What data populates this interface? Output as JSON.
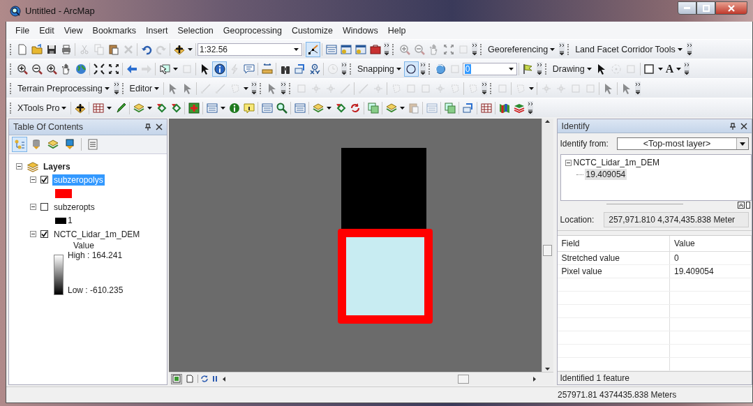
{
  "window": {
    "title": "Untitled - ArcMap"
  },
  "menu": [
    "File",
    "Edit",
    "View",
    "Bookmarks",
    "Insert",
    "Selection",
    "Geoprocessing",
    "Customize",
    "Windows",
    "Help"
  ],
  "toolbars": [
    {
      "items": [
        {
          "kind": "grip"
        },
        {
          "kind": "tool",
          "selected": false,
          "disabled": false
        },
        {
          "kind": "tool",
          "selected": false,
          "disabled": false
        },
        {
          "kind": "tool",
          "selected": false,
          "disabled": false
        },
        {
          "kind": "tool",
          "selected": false,
          "disabled": false
        },
        {
          "kind": "separator"
        },
        {
          "kind": "tool",
          "selected": false,
          "disabled": true
        },
        {
          "kind": "tool",
          "selected": false,
          "disabled": true
        },
        {
          "kind": "tool",
          "selected": false,
          "disabled": false
        },
        {
          "kind": "tool",
          "selected": false,
          "disabled": true
        },
        {
          "kind": "separator"
        },
        {
          "kind": "tool",
          "selected": false,
          "disabled": false
        },
        {
          "kind": "tool",
          "selected": false,
          "disabled": true
        },
        {
          "kind": "separator"
        },
        {
          "kind": "tool",
          "selected": false,
          "disabled": false
        },
        {
          "kind": "caret"
        },
        {
          "kind": "separator"
        },
        {
          "kind": "scale",
          "value": "1:32.56"
        },
        {
          "kind": "separator"
        },
        {
          "kind": "tool",
          "selected": true,
          "disabled": false
        },
        {
          "kind": "separator"
        },
        {
          "kind": "tool",
          "selected": false,
          "disabled": false
        },
        {
          "kind": "tool",
          "selected": false,
          "disabled": false
        },
        {
          "kind": "tool",
          "selected": false,
          "disabled": false
        },
        {
          "kind": "tool",
          "selected": false,
          "disabled": false
        },
        {
          "kind": "options"
        },
        {
          "kind": "grip"
        },
        {
          "kind": "tool",
          "selected": false,
          "disabled": true
        },
        {
          "kind": "tool",
          "selected": false,
          "disabled": true
        },
        {
          "kind": "tool",
          "selected": false,
          "disabled": true
        },
        {
          "kind": "tool",
          "selected": false,
          "disabled": true
        },
        {
          "kind": "tool",
          "selected": false,
          "disabled": true
        },
        {
          "kind": "options"
        },
        {
          "kind": "grip"
        },
        {
          "kind": "menu",
          "label": "Georeferencing"
        },
        {
          "kind": "options"
        },
        {
          "kind": "grip"
        },
        {
          "kind": "menu",
          "label": "Land Facet Corridor Tools"
        },
        {
          "kind": "options"
        }
      ]
    },
    {
      "items": [
        {
          "kind": "grip"
        },
        {
          "kind": "tool",
          "selected": false,
          "disabled": false
        },
        {
          "kind": "tool",
          "selected": false,
          "disabled": false
        },
        {
          "kind": "tool",
          "selected": false,
          "disabled": false
        },
        {
          "kind": "tool",
          "selected": false,
          "disabled": false
        },
        {
          "kind": "tool",
          "selected": false,
          "disabled": false
        },
        {
          "kind": "separator"
        },
        {
          "kind": "tool",
          "selected": false,
          "disabled": false
        },
        {
          "kind": "tool",
          "selected": false,
          "disabled": false
        },
        {
          "kind": "separator"
        },
        {
          "kind": "tool",
          "selected": false,
          "disabled": false
        },
        {
          "kind": "tool",
          "selected": false,
          "disabled": true
        },
        {
          "kind": "separator"
        },
        {
          "kind": "tool",
          "selected": false,
          "disabled": false
        },
        {
          "kind": "caret"
        },
        {
          "kind": "tool",
          "selected": false,
          "disabled": true
        },
        {
          "kind": "separator"
        },
        {
          "kind": "tool",
          "selected": false,
          "disabled": false
        },
        {
          "kind": "tool",
          "selected": true,
          "disabled": false
        },
        {
          "kind": "tool",
          "selected": false,
          "disabled": true
        },
        {
          "kind": "tool",
          "selected": false,
          "disabled": false
        },
        {
          "kind": "separator"
        },
        {
          "kind": "tool",
          "selected": false,
          "disabled": false
        },
        {
          "kind": "separator"
        },
        {
          "kind": "tool",
          "selected": false,
          "disabled": false
        },
        {
          "kind": "tool",
          "selected": false,
          "disabled": false
        },
        {
          "kind": "tool",
          "selected": false,
          "disabled": false
        },
        {
          "kind": "separator"
        },
        {
          "kind": "tool",
          "selected": false,
          "disabled": true
        },
        {
          "kind": "options"
        },
        {
          "kind": "grip"
        },
        {
          "kind": "menu",
          "label": "Snapping"
        },
        {
          "kind": "tool",
          "selected": true,
          "disabled": false
        },
        {
          "kind": "options"
        },
        {
          "kind": "grip"
        },
        {
          "kind": "tool",
          "selected": false,
          "disabled": false
        },
        {
          "kind": "tool",
          "selected": false,
          "disabled": true
        },
        {
          "kind": "layerbox",
          "value": "0"
        },
        {
          "kind": "separator"
        },
        {
          "kind": "tool",
          "selected": false,
          "disabled": false
        },
        {
          "kind": "options"
        },
        {
          "kind": "grip"
        },
        {
          "kind": "menu",
          "label": "Drawing"
        },
        {
          "kind": "tool",
          "selected": false,
          "disabled": false
        },
        {
          "kind": "tool",
          "selected": false,
          "disabled": true
        },
        {
          "kind": "tool",
          "selected": false,
          "disabled": true
        },
        {
          "kind": "separator"
        },
        {
          "kind": "tool",
          "selected": false,
          "disabled": false
        },
        {
          "kind": "caret"
        },
        {
          "kind": "glyph",
          "text": "A"
        },
        {
          "kind": "caret"
        },
        {
          "kind": "options"
        }
      ]
    },
    {
      "items": [
        {
          "kind": "grip"
        },
        {
          "kind": "menu",
          "label": "Terrain Preprocessing"
        },
        {
          "kind": "options"
        },
        {
          "kind": "grip"
        },
        {
          "kind": "menu",
          "label": "Editor"
        },
        {
          "kind": "separator"
        },
        {
          "kind": "tool",
          "selected": false,
          "disabled": true
        },
        {
          "kind": "tool",
          "selected": false,
          "disabled": true
        },
        {
          "kind": "separator"
        },
        {
          "kind": "tool",
          "selected": false,
          "disabled": true
        },
        {
          "kind": "tool",
          "selected": false,
          "disabled": true
        },
        {
          "kind": "tool",
          "selected": false,
          "disabled": true
        },
        {
          "kind": "caret"
        },
        {
          "kind": "options"
        },
        {
          "kind": "grip"
        },
        {
          "kind": "tool",
          "selected": false,
          "disabled": true
        },
        {
          "kind": "options"
        },
        {
          "kind": "grip"
        },
        {
          "kind": "tool",
          "selected": false,
          "disabled": true
        },
        {
          "kind": "tool",
          "selected": false,
          "disabled": true
        },
        {
          "kind": "tool",
          "selected": false,
          "disabled": true
        },
        {
          "kind": "tool",
          "selected": false,
          "disabled": true
        },
        {
          "kind": "separator"
        },
        {
          "kind": "tool",
          "selected": false,
          "disabled": true
        },
        {
          "kind": "tool",
          "selected": false,
          "disabled": true
        },
        {
          "kind": "separator"
        },
        {
          "kind": "tool",
          "selected": false,
          "disabled": true
        },
        {
          "kind": "tool",
          "selected": false,
          "disabled": true
        },
        {
          "kind": "tool",
          "selected": false,
          "disabled": true
        },
        {
          "kind": "tool",
          "selected": false,
          "disabled": true
        },
        {
          "kind": "tool",
          "selected": false,
          "disabled": true
        },
        {
          "kind": "separator"
        },
        {
          "kind": "tool",
          "selected": false,
          "disabled": true
        },
        {
          "kind": "options"
        },
        {
          "kind": "grip"
        },
        {
          "kind": "tool",
          "selected": false,
          "disabled": true
        },
        {
          "kind": "separator"
        },
        {
          "kind": "tool",
          "selected": false,
          "disabled": true
        },
        {
          "kind": "caret"
        },
        {
          "kind": "separator"
        },
        {
          "kind": "tool",
          "selected": false,
          "disabled": true
        },
        {
          "kind": "tool",
          "selected": false,
          "disabled": true
        },
        {
          "kind": "tool",
          "selected": false,
          "disabled": true
        },
        {
          "kind": "tool",
          "selected": false,
          "disabled": true
        },
        {
          "kind": "separator"
        },
        {
          "kind": "tool",
          "selected": false,
          "disabled": true
        },
        {
          "kind": "separator"
        },
        {
          "kind": "tool",
          "selected": false,
          "disabled": true
        },
        {
          "kind": "options"
        }
      ]
    },
    {
      "items": [
        {
          "kind": "grip"
        },
        {
          "kind": "menu",
          "label": "XTools Pro"
        },
        {
          "kind": "separator"
        },
        {
          "kind": "tool",
          "selected": false,
          "disabled": false
        },
        {
          "kind": "separator"
        },
        {
          "kind": "tool",
          "selected": false,
          "disabled": false
        },
        {
          "kind": "caret"
        },
        {
          "kind": "tool",
          "selected": false,
          "disabled": false
        },
        {
          "kind": "separator"
        },
        {
          "kind": "tool",
          "selected": false,
          "disabled": false
        },
        {
          "kind": "caret"
        },
        {
          "kind": "tool",
          "selected": false,
          "disabled": false
        },
        {
          "kind": "tool",
          "selected": false,
          "disabled": false
        },
        {
          "kind": "separator"
        },
        {
          "kind": "tool",
          "selected": false,
          "disabled": false
        },
        {
          "kind": "separator"
        },
        {
          "kind": "tool",
          "selected": false,
          "disabled": false
        },
        {
          "kind": "caret"
        },
        {
          "kind": "tool",
          "selected": false,
          "disabled": false
        },
        {
          "kind": "tool",
          "selected": false,
          "disabled": false
        },
        {
          "kind": "separator"
        },
        {
          "kind": "tool",
          "selected": false,
          "disabled": false
        },
        {
          "kind": "tool",
          "selected": false,
          "disabled": false
        },
        {
          "kind": "separator"
        },
        {
          "kind": "tool",
          "selected": false,
          "disabled": false
        },
        {
          "kind": "separator"
        },
        {
          "kind": "tool",
          "selected": false,
          "disabled": false
        },
        {
          "kind": "caret"
        },
        {
          "kind": "tool",
          "selected": false,
          "disabled": false
        },
        {
          "kind": "tool",
          "selected": false,
          "disabled": false
        },
        {
          "kind": "separator"
        },
        {
          "kind": "tool",
          "selected": false,
          "disabled": false
        },
        {
          "kind": "separator"
        },
        {
          "kind": "tool",
          "selected": false,
          "disabled": false
        },
        {
          "kind": "caret"
        },
        {
          "kind": "tool",
          "selected": false,
          "disabled": true
        },
        {
          "kind": "separator"
        },
        {
          "kind": "tool",
          "selected": false,
          "disabled": true
        },
        {
          "kind": "separator"
        },
        {
          "kind": "tool",
          "selected": false,
          "disabled": false
        },
        {
          "kind": "separator"
        },
        {
          "kind": "tool",
          "selected": false,
          "disabled": false
        },
        {
          "kind": "separator"
        },
        {
          "kind": "tool",
          "selected": false,
          "disabled": false
        },
        {
          "kind": "separator"
        },
        {
          "kind": "tool",
          "selected": false,
          "disabled": false
        },
        {
          "kind": "tool",
          "selected": false,
          "disabled": false
        },
        {
          "kind": "options"
        }
      ]
    }
  ],
  "toc": {
    "title": "Table Of Contents",
    "view_buttons": [
      {
        "selected": true
      },
      {
        "selected": false
      },
      {
        "selected": false
      },
      {
        "selected": false
      },
      {
        "selected": false
      }
    ],
    "root": {
      "label": "Layers",
      "expanded": true,
      "children": [
        {
          "label": "subzeropolys",
          "checked": true,
          "selected": true,
          "expanded": true,
          "legend": {
            "kind": "patch",
            "color": "#ff0000"
          }
        },
        {
          "label": "subzeropts",
          "checked": false,
          "selected": false,
          "expanded": true,
          "legend": {
            "kind": "patch",
            "color": "#000000",
            "label": "1"
          }
        },
        {
          "label": "NCTC_Lidar_1m_DEM",
          "checked": true,
          "selected": false,
          "expanded": true,
          "legend": {
            "kind": "ramp",
            "title": "Value",
            "high": "High : 164.241",
            "low": "Low : -610.235"
          }
        }
      ]
    }
  },
  "map": {
    "views": [
      {
        "selected": true
      },
      {
        "selected": false
      }
    ]
  },
  "identify": {
    "title": "Identify",
    "from_label": "Identify from:",
    "from_value": "<Top-most layer>",
    "tree": {
      "label": "NCTC_Lidar_1m_DEM",
      "expanded": true,
      "children": [
        {
          "label": "19.409054",
          "selected": true
        }
      ]
    },
    "location_label": "Location:",
    "location_value": "257,971.810  4,374,435.838 Meter",
    "columns": [
      "Field",
      "Value"
    ],
    "rows": [
      [
        "Stretched value",
        "0"
      ],
      [
        "Pixel value",
        "19.409054"
      ]
    ],
    "footer": "Identified 1 feature"
  },
  "status_bar": {
    "coordinates": "257971.81  4374435.838 Meters"
  }
}
